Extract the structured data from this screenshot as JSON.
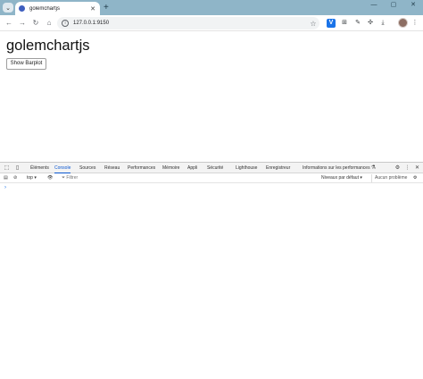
{
  "browser": {
    "tab": {
      "title": "golemchartjs"
    },
    "window_controls": {
      "minimize": "—",
      "restore": "▢",
      "close": "✕"
    },
    "address_bar": {
      "url": "127.0.0.1:9150"
    }
  },
  "page": {
    "title": "golemchartjs",
    "button_label": "Show Barplot"
  },
  "devtools": {
    "tabs": [
      "Éléments",
      "Console",
      "Sources",
      "Réseau",
      "Performances",
      "Mémoire",
      "Appli",
      "Sécurité",
      "Lighthouse",
      "Enregistreur",
      "Informations sur les performances"
    ],
    "active_tab": "Console",
    "console": {
      "context": "top",
      "filter_placeholder": "Filtrer",
      "levels": "Niveaux par défaut",
      "issues": "Aucun problème",
      "prompt": "›"
    }
  },
  "colors": {
    "tabstrip": "#8fb5c8",
    "active_tab_accent": "#0b57d0"
  }
}
